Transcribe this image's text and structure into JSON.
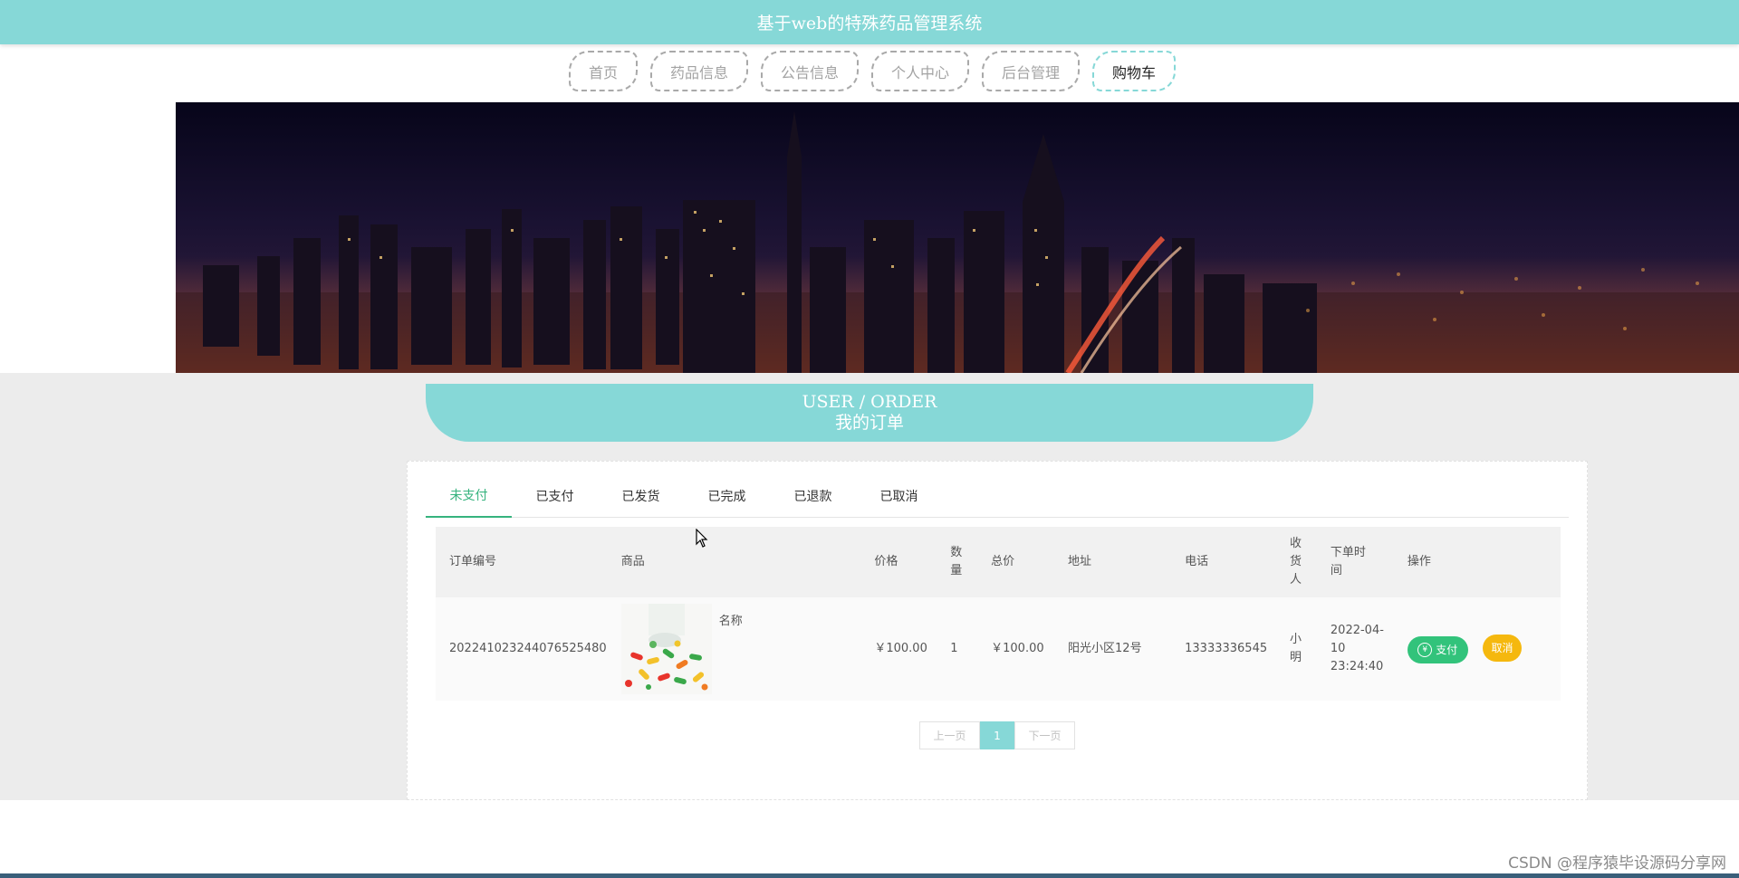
{
  "header": {
    "title": "基于web的特殊药品管理系统"
  },
  "nav": [
    {
      "label": "首页",
      "active": false
    },
    {
      "label": "药品信息",
      "active": false
    },
    {
      "label": "公告信息",
      "active": false
    },
    {
      "label": "个人中心",
      "active": false
    },
    {
      "label": "后台管理",
      "active": false
    },
    {
      "label": "购物车",
      "active": true
    }
  ],
  "banner": {
    "image": "city-night-skyline"
  },
  "order_section": {
    "en_title": "USER / ORDER",
    "cn_title": "我的订单"
  },
  "tabs": [
    {
      "label": "未支付",
      "active": true
    },
    {
      "label": "已支付",
      "active": false
    },
    {
      "label": "已发货",
      "active": false
    },
    {
      "label": "已完成",
      "active": false
    },
    {
      "label": "已退款",
      "active": false
    },
    {
      "label": "已取消",
      "active": false
    }
  ],
  "table": {
    "headers": {
      "order_no": "订单编号",
      "product": "商品",
      "price": "价格",
      "qty": "数量",
      "total": "总价",
      "address": "地址",
      "phone": "电话",
      "receiver": "收货人",
      "time": "下单时间",
      "ops": "操作"
    },
    "rows": [
      {
        "order_no": "202241023244076525480",
        "product_name": "名称",
        "product_image": "colorful-pills-thumbnail",
        "price": "￥100.00",
        "qty": "1",
        "total": "￥100.00",
        "address": "阳光小区12号",
        "phone": "13333336545",
        "receiver": "小明",
        "time": "2022-04-10 23:24:40",
        "pay_label": "支付",
        "cancel_label": "取消"
      }
    ]
  },
  "pagination": {
    "prev": "上一页",
    "current": "1",
    "next": "下一页"
  },
  "watermark": "CSDN @程序猿毕设源码分享网",
  "colors": {
    "accent": "#86d8d7",
    "tab_active": "#36b37e",
    "pay": "#32c37b",
    "cancel": "#f5b80e"
  }
}
